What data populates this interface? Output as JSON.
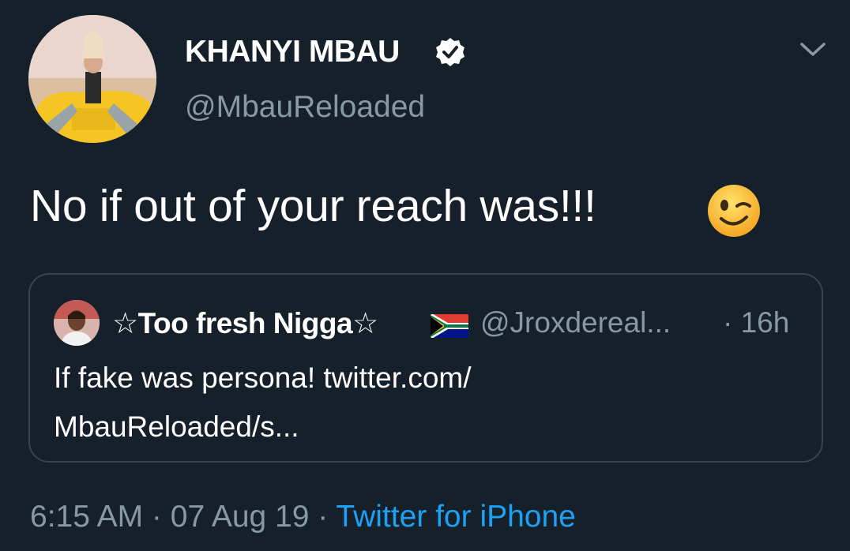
{
  "author": {
    "name": "KHANYI MBAU",
    "handle": "@MbauReloaded",
    "verified": true
  },
  "tweet": {
    "text": "No if out of your reach was!!!",
    "emoji": "winking-face"
  },
  "quoted_tweet": {
    "name": "☆Too fresh Nigga☆",
    "flag": "south-africa-flag",
    "handle": "@Jroxdereal...",
    "time": "· 16h",
    "text_line1": "If fake was persona! twitter.com/",
    "text_line2": "MbauReloaded/s..."
  },
  "meta": {
    "time": "6:15 AM",
    "sep1": " · ",
    "date": "07 Aug 19",
    "sep2": " · ",
    "source": "Twitter for iPhone"
  },
  "colors": {
    "background": "#15202b",
    "secondary_text": "#8899a6",
    "link": "#1da1f2",
    "border": "#38444d"
  }
}
